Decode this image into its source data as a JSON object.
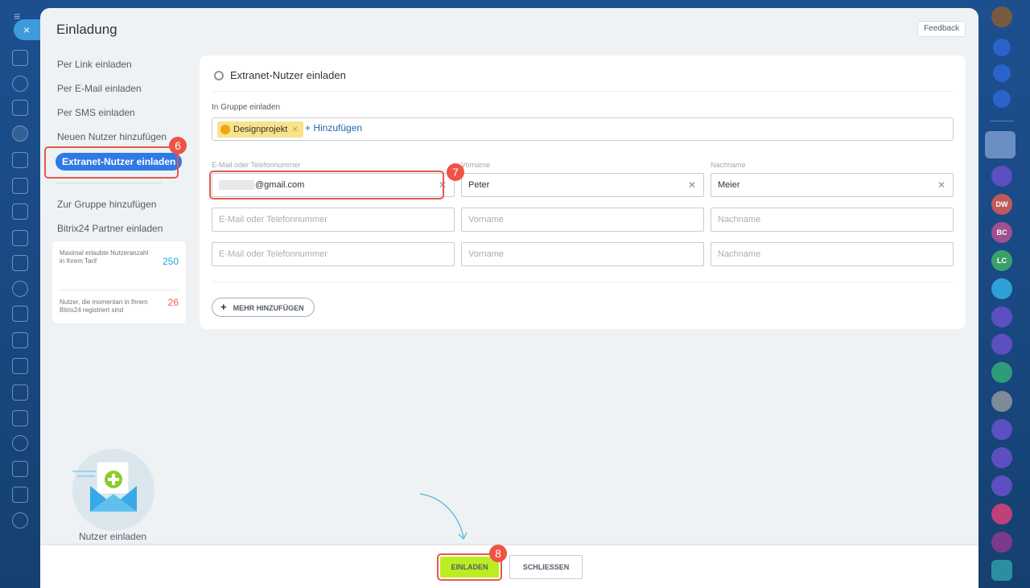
{
  "dialog": {
    "title": "Einladung",
    "feedback_label": "Feedback"
  },
  "nav": {
    "items": [
      {
        "label": "Per Link einladen"
      },
      {
        "label": "Per E-Mail einladen"
      },
      {
        "label": "Per SMS einladen"
      },
      {
        "label": "Neuen Nutzer hinzufügen"
      },
      {
        "label": "Extranet-Nutzer einladen",
        "active": true
      }
    ],
    "items2": [
      {
        "label": "Zur Gruppe hinzufügen"
      },
      {
        "label": "Bitrix24 Partner einladen"
      }
    ]
  },
  "stats": {
    "max_label": "Maximal erlaubte Nutzeranzahl in Ihrem Tarif",
    "max_value": "250",
    "current_label": "Nutzer, die momentan in Ihrem Bitrix24 registriert sind",
    "current_value": "26"
  },
  "illustration_label": "Nutzer einladen",
  "card": {
    "title": "Extranet-Nutzer einladen",
    "group_label": "In Gruppe einladen",
    "group_tag": "Designprojekt",
    "add_link": "+ Hinzufügen",
    "col_email": "E-Mail oder Telefonnummer",
    "col_first": "Vorname",
    "col_last": "Nachname",
    "rows": [
      {
        "email": "@gmail.com",
        "first": "Peter",
        "last": "Meier"
      },
      {
        "email_ph": "E-Mail oder Telefonnummer",
        "first_ph": "Vorname",
        "last_ph": "Nachname"
      },
      {
        "email_ph": "E-Mail oder Telefonnummer",
        "first_ph": "Vorname",
        "last_ph": "Nachname"
      }
    ],
    "more_label": "MEHR HINZUFÜGEN"
  },
  "footer": {
    "invite_label": "EINLADEN",
    "close_label": "SCHLIESSEN"
  },
  "badges": {
    "b6": "6",
    "b7": "7",
    "b8": "8"
  },
  "right_rail": {
    "avatars": [
      "DW",
      "BC",
      "LC"
    ]
  },
  "colors": {
    "accent": "#2f7ae5",
    "invite_green": "#bbed21",
    "highlight_red": "#f05345"
  }
}
